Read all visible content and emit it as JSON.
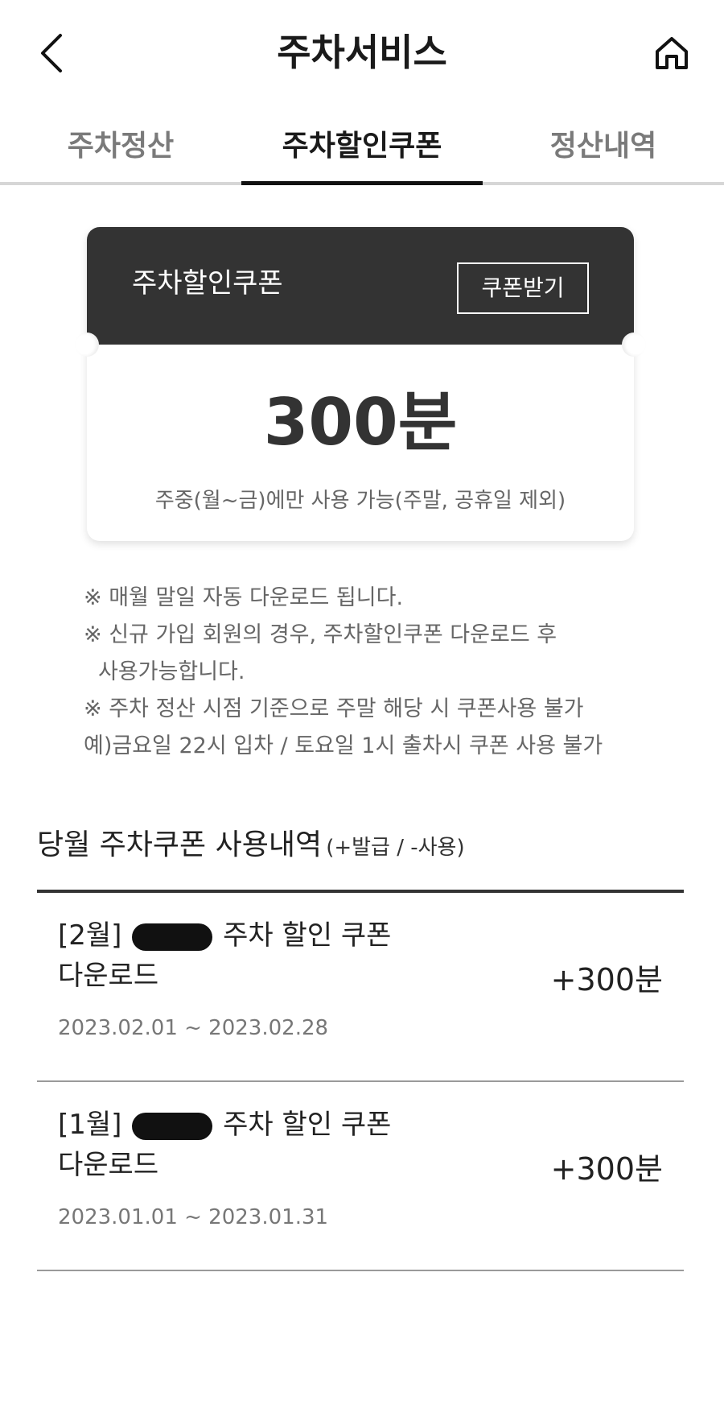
{
  "header": {
    "title": "주차서비스"
  },
  "tabs": [
    {
      "label": "주차정산",
      "active": false
    },
    {
      "label": "주차할인쿠폰",
      "active": true
    },
    {
      "label": "정산내역",
      "active": false
    }
  ],
  "coupon": {
    "title": "주차할인쿠폰",
    "button_label": "쿠폰받기",
    "amount": "300분",
    "note": "주중(월~금)에만 사용 가능(주말, 공휴일 제외)"
  },
  "notices": [
    "※ 매월 말일 자동 다운로드 됩니다.",
    "※ 신규 가입 회원의 경우, 주차할인쿠폰 다운로드 후",
    "사용가능합니다.",
    "※ 주차 정산 시점 기준으로 주말 해당 시 쿠폰사용 불가",
    "예)금요일 22시 입차 / 토요일 1시 출차시 쿠폰 사용 불가"
  ],
  "history": {
    "title": "당월 주차쿠폰 사용내역",
    "subtitle": "(+발급 / -사용)",
    "items": [
      {
        "prefix": "[2월]",
        "label": "주차 할인 쿠폰",
        "line2": "다운로드",
        "period": "2023.02.01 ~ 2023.02.28",
        "amount": "+300분"
      },
      {
        "prefix": "[1월]",
        "label": "주차 할인 쿠폰",
        "line2": "다운로드",
        "period": "2023.01.01 ~ 2023.01.31",
        "amount": "+300분"
      }
    ]
  },
  "colors": {
    "coupon_header": "#333333",
    "active_tab_indicator": "#111111",
    "muted_text": "#666666"
  },
  "icons": {
    "back": "chevron-left-icon",
    "home": "home-icon"
  }
}
